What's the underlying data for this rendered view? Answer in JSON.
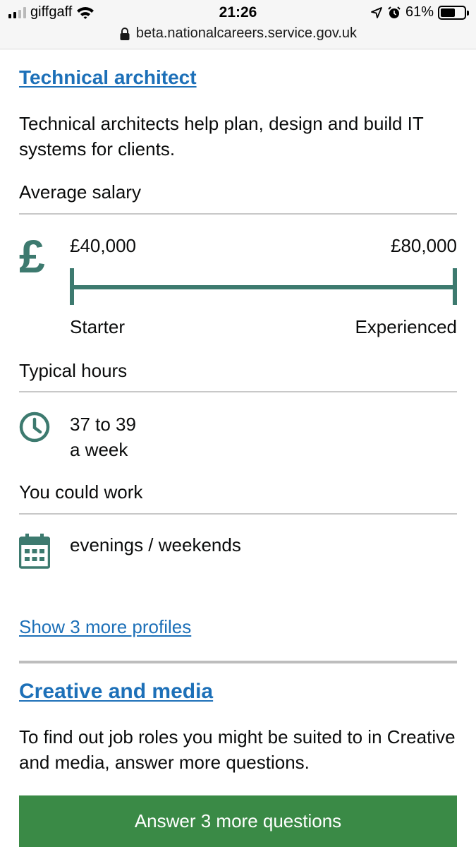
{
  "status_bar": {
    "carrier": "giffgaff",
    "time": "21:26",
    "battery_percent": "61%",
    "battery_level": 0.61,
    "url": "beta.nationalcareers.service.gov.uk"
  },
  "profile": {
    "title": "Technical architect",
    "description": "Technical architects help plan, design and build IT systems for clients.",
    "salary": {
      "label": "Average salary",
      "icon": "pound-icon",
      "currency_symbol": "£",
      "starter_value": "£40,000",
      "experienced_value": "£80,000",
      "starter_label": "Starter",
      "experienced_label": "Experienced"
    },
    "hours": {
      "label": "Typical hours",
      "icon": "clock-icon",
      "range": "37 to 39",
      "unit": "a week"
    },
    "work": {
      "label": "You could work",
      "icon": "calendar-icon",
      "value": "evenings / weekends"
    }
  },
  "more_profiles_link": "Show 3 more profiles",
  "category": {
    "title": "Creative and media",
    "description": "To find out job roles you might be suited to in Creative and media, answer more questions.",
    "button_label": "Answer 3 more questions"
  },
  "colors": {
    "link": "#1d70b8",
    "accent_teal": "#3d7a6f",
    "button_green": "#3a8a46",
    "text": "#0b0c0c"
  }
}
